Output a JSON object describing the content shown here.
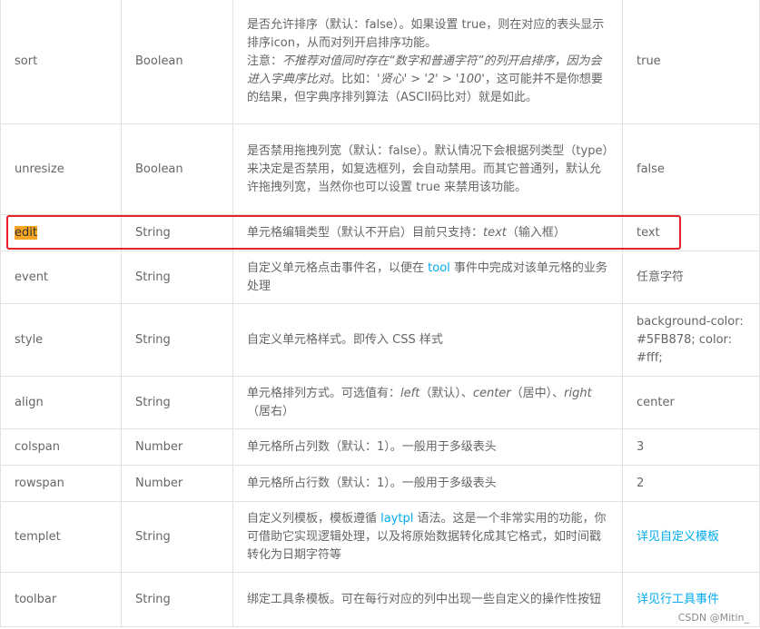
{
  "rows": [
    {
      "name": "sort",
      "type": "Boolean",
      "desc_line1": "是否允许排序（默认：false）。如果设置 true，则在对应的表头显示排序icon，从而对列开启排序功能。",
      "desc_note_prefix": "注意：",
      "desc_note_italic1": "不推荐对值同时存在“数字和普通字符”的列开启排序，因为会进入字典序比对",
      "desc_note_mid": "。比如：",
      "desc_note_italic2": "'贤心' > '2' > '100'",
      "desc_note_suffix": "，这可能并不是你想要的结果，但字典序排列算法（ASCII码比对）就是如此。",
      "default": "true"
    },
    {
      "name": "unresize",
      "type": "Boolean",
      "desc": "是否禁用拖拽列宽（默认：false）。默认情况下会根据列类型（type）来决定是否禁用，如复选框列，会自动禁用。而其它普通列，默认允许拖拽列宽，当然你也可以设置 true 来禁用该功能。",
      "default": "false"
    },
    {
      "name": "edit",
      "type": "String",
      "desc_prefix": "单元格编辑类型（默认不开启）目前只支持：",
      "desc_italic": "text",
      "desc_suffix": "（输入框）",
      "default": "text"
    },
    {
      "name": "event",
      "type": "String",
      "desc_prefix": "自定义单元格点击事件名，以便在 ",
      "desc_link": "tool",
      "desc_suffix": " 事件中完成对该单元格的业务处理",
      "default": "任意字符"
    },
    {
      "name": "style",
      "type": "String",
      "desc": "自定义单元格样式。即传入 CSS 样式",
      "default": "background-color: #5FB878; color: #fff;"
    },
    {
      "name": "align",
      "type": "String",
      "desc_prefix": "单元格排列方式。可选值有：",
      "desc_i1": "left",
      "desc_t1": "（默认）、",
      "desc_i2": "center",
      "desc_t2": "（居中）、",
      "desc_i3": "right",
      "desc_t3": "（居右）",
      "default": "center"
    },
    {
      "name": "colspan",
      "type": "Number",
      "desc": "单元格所占列数（默认：1）。一般用于多级表头",
      "default": "3"
    },
    {
      "name": "rowspan",
      "type": "Number",
      "desc": "单元格所占行数（默认：1）。一般用于多级表头",
      "default": "2"
    },
    {
      "name": "templet",
      "type": "String",
      "desc_prefix": "自定义列模板，模板遵循 ",
      "desc_link": "laytpl",
      "desc_suffix": " 语法。这是一个非常实用的功能，你可借助它实现逻辑处理，以及将原始数据转化成其它格式，如时间戳转化为日期字符等",
      "default": "详见自定义模板"
    },
    {
      "name": "toolbar",
      "type": "String",
      "desc": "绑定工具条模板。可在每行对应的列中出现一些自定义的操作性按钮",
      "default": "详见行工具事件"
    }
  ],
  "watermark": "CSDN @Mitin_",
  "colors": {
    "highlight": "#f6a623",
    "link": "#01AAED",
    "box": "#e8202a",
    "border": "#e2e2e2"
  }
}
